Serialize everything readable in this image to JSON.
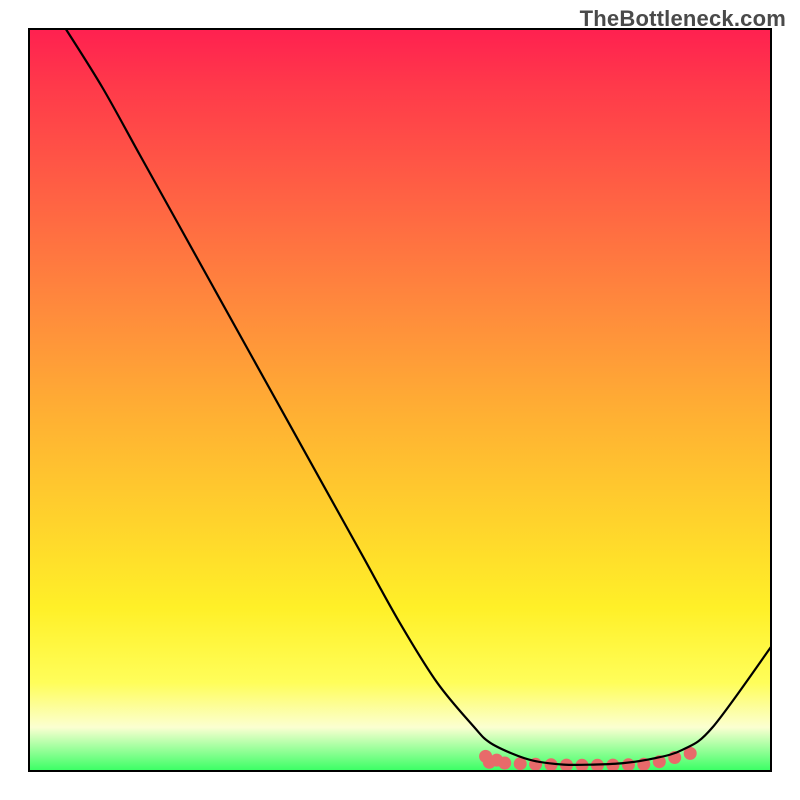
{
  "watermark": "TheBottleneck.com",
  "chart_data": {
    "type": "line",
    "title": "",
    "xlabel": "",
    "ylabel": "",
    "xlim": [
      0,
      100
    ],
    "ylim": [
      0,
      100
    ],
    "grid": false,
    "legend": false,
    "colors": {
      "gradient_top": "#ff2050",
      "gradient_bottom": "#34ff61",
      "curve": "#000000",
      "valley_marker": "#e86a6a"
    },
    "series": [
      {
        "name": "bottleneck-curve",
        "x": [
          5,
          10,
          15,
          20,
          25,
          30,
          35,
          40,
          45,
          50,
          55,
          60,
          62,
          65,
          68,
          72,
          76,
          80,
          84,
          88,
          92,
          100
        ],
        "y": [
          100,
          92,
          83,
          74,
          65,
          56,
          47,
          38,
          29,
          20,
          12,
          6,
          4,
          2.5,
          1.5,
          1,
          1,
          1.2,
          1.8,
          3,
          6,
          17
        ]
      }
    ],
    "annotations": [
      {
        "name": "optimal-range-marker",
        "x_range": [
          62,
          89
        ],
        "y": 1.3,
        "style": "thick-rose-dots"
      }
    ]
  }
}
